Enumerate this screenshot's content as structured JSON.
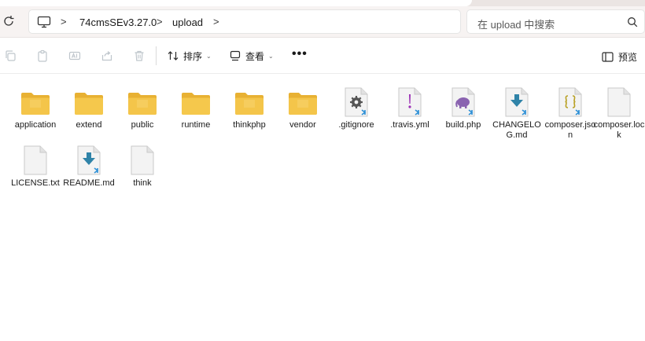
{
  "address_bar": {
    "computer_icon": "computer-icon",
    "breadcrumbs": [
      "74cmsSEv3.27.0",
      "upload"
    ],
    "separator": ">"
  },
  "search": {
    "placeholder": "在 upload 中搜索"
  },
  "toolbar": {
    "sort_label": "排序",
    "view_label": "查看",
    "more_label": "•••",
    "preview_label": "预览"
  },
  "files": [
    {
      "name": "application",
      "type": "folder"
    },
    {
      "name": "extend",
      "type": "folder"
    },
    {
      "name": "public",
      "type": "folder"
    },
    {
      "name": "runtime",
      "type": "folder"
    },
    {
      "name": "thinkphp",
      "type": "folder"
    },
    {
      "name": "vendor",
      "type": "folder"
    },
    {
      "name": ".gitignore",
      "type": "gear-file"
    },
    {
      "name": ".travis.yml",
      "type": "yml-file"
    },
    {
      "name": "build.php",
      "type": "php-file"
    },
    {
      "name": "CHANGELOG.md",
      "type": "md-file"
    },
    {
      "name": "composer.json",
      "type": "json-file"
    },
    {
      "name": "composer.lock",
      "type": "blank-file"
    },
    {
      "name": "LICENSE.txt",
      "type": "txt-file"
    },
    {
      "name": "README.md",
      "type": "md-file"
    },
    {
      "name": "think",
      "type": "blank-file"
    }
  ],
  "colors": {
    "folder": "#f5c84c",
    "folder_back": "#e8b133",
    "md_arrow": "#2f83a8",
    "php_elephant": "#8a63b0",
    "yml_mark": "#9b30b5",
    "json_mark": "#b8a023",
    "gear": "#555555",
    "vscode_badge": "#2c8fd6"
  }
}
